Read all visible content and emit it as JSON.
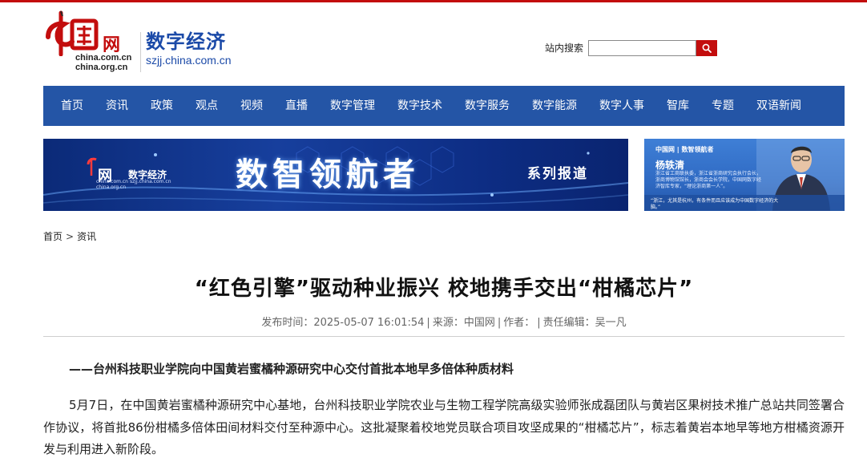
{
  "site": {
    "logo_text": "中国网",
    "logo_net": "网",
    "domain_line1": "china.com.cn",
    "domain_line2": "china.org.cn",
    "channel_name": "数字经济",
    "channel_domain": "szjj.china.com.cn"
  },
  "search": {
    "label": "站内搜索",
    "value": "",
    "icon": "search-icon"
  },
  "nav": {
    "items": [
      "首页",
      "资讯",
      "政策",
      "观点",
      "视频",
      "直播",
      "数字管理",
      "数字技术",
      "数字服务",
      "数字能源",
      "数字人事",
      "智库",
      "专题",
      "双语新闻"
    ]
  },
  "banner_main": {
    "logo_net": "网",
    "logo_cn": "数字经济",
    "dom1": "china.com.cn",
    "dom2": "china.org.cn",
    "dom3": "szjj.china.com.cn",
    "title": "数智领航者",
    "subtitle": "系列报道"
  },
  "banner_side": {
    "logo": "中国网 | 数智领航者",
    "name": "杨轶清",
    "desc": "浙江省工商联执委，浙江省浙商研究会执行会长，浙商博物馆馆长，浙商会会长学院，中国网数字经济智库专家，“理论浙商第一人”。",
    "quote": "“浙江，尤其是杭州，有条件而且应该成为中国数字经济的大脑。”"
  },
  "breadcrumb": {
    "home": "首页",
    "sep": ">",
    "section": "资讯"
  },
  "article": {
    "title": "“红色引擎”驱动种业振兴 校地携手交出“柑橘芯片”",
    "meta": {
      "time_label": "发布时间：",
      "time": "2025-05-07 16:01:54",
      "source_label": "来源：",
      "source": "中国网",
      "author_label": "作者：",
      "author": "",
      "editor_label": "责任编辑：",
      "editor": "吴一凡"
    },
    "subtitle": "——台州科技职业学院向中国黄岩蜜橘种源研究中心交付首批本地早多倍体种质材料",
    "paragraph": "5月7日，在中国黄岩蜜橘种源研究中心基地，台州科技职业学院农业与生物工程学院高级实验师张成磊团队与黄岩区果树技术推广总站共同签署合作协议，将首批86份柑橘多倍体田间材料交付至种源中心。这批凝聚着校地党员联合项目攻坚成果的“柑橘芯片”，标志着黄岩本地早等地方柑橘资源开发与利用进入新阶段。"
  },
  "colors": {
    "brand_red": "#c30d0d",
    "nav_blue": "#2455a6",
    "channel_blue": "#1b4aa8"
  }
}
